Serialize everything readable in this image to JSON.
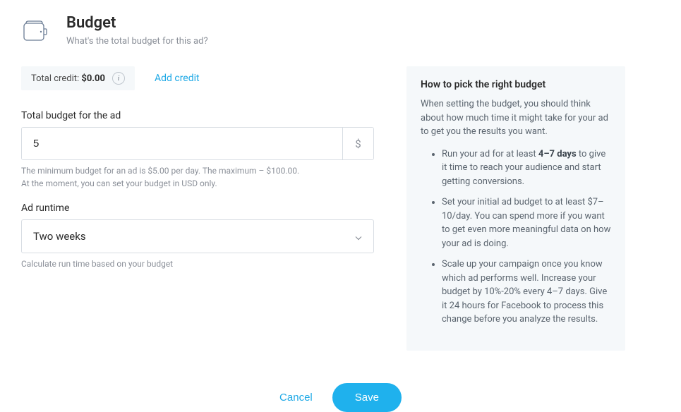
{
  "header": {
    "title": "Budget",
    "subtitle": "What's the total budget for this ad?"
  },
  "credit": {
    "label": "Total credit: ",
    "amount": "$0.00",
    "info_tooltip": "i",
    "add_credit_label": "Add credit"
  },
  "budget_field": {
    "label": "Total budget for the ad",
    "value": "5",
    "currency_symbol": "$",
    "helper_line1": "The minimum budget for an ad is $5.00 per day. The maximum – $100.00.",
    "helper_line2": "At the moment, you can set your budget in USD only."
  },
  "runtime_field": {
    "label": "Ad runtime",
    "value": "Two weeks",
    "helper": "Calculate run time based on your budget"
  },
  "tips": {
    "title": "How to pick the right budget",
    "intro": "When setting the budget, you should think about how much time it might take for your ad to get you the results you want.",
    "items": [
      {
        "prefix": "Run your ad for at least ",
        "bold": "4–7 days",
        "suffix": " to give it time to reach your audience and start getting conversions."
      },
      {
        "prefix": "Set your initial ad budget to at least $7–10/day. You can spend more if you want to get even more meaningful data on how your ad is doing.",
        "bold": "",
        "suffix": ""
      },
      {
        "prefix": "Scale up your campaign once you know which ad performs well. Increase your budget by 10%-20% every 4–7 days. Give it 24 hours for Facebook to process this change before you analyze the results.",
        "bold": "",
        "suffix": ""
      }
    ]
  },
  "actions": {
    "cancel": "Cancel",
    "save": "Save"
  }
}
